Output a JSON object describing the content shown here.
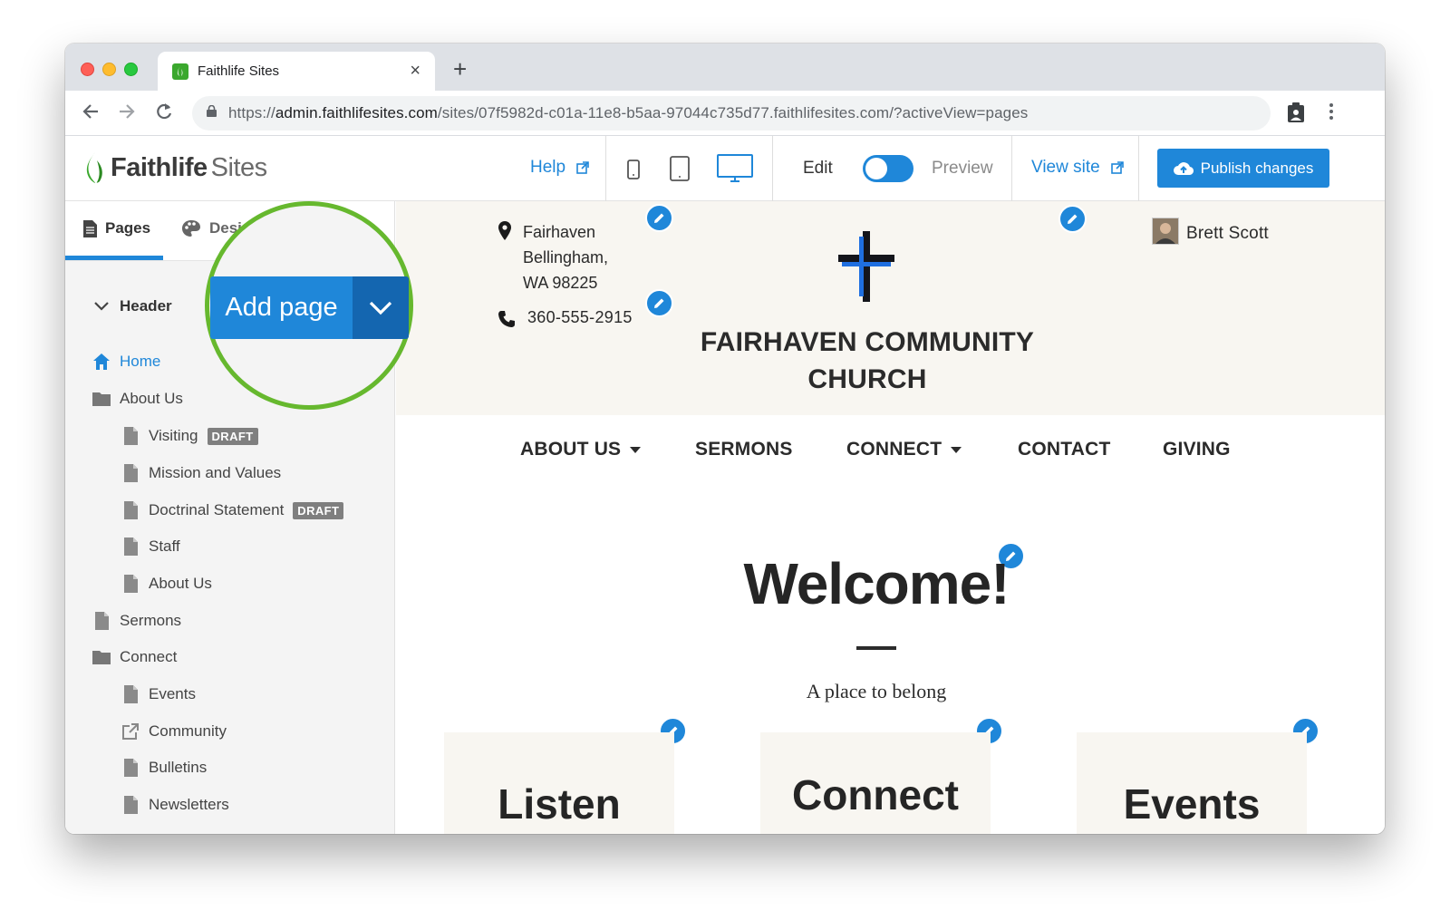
{
  "browser": {
    "tab_title": "Faithlife Sites",
    "tab_close": "×",
    "new_tab": "+",
    "url_prefix": "https://",
    "url_host": "admin.faithlifesites.com",
    "url_path": "/sites/07f5982d-c01a-11e8-b5aa-97044c735d77.faithlifesites.com/?activeView=pages",
    "back_icon": "arrow-left-icon",
    "forward_icon": "arrow-right-icon",
    "reload_icon": "reload-icon"
  },
  "app": {
    "logo_bold": "Faithlife",
    "logo_light": "Sites",
    "help": "Help",
    "edit": "Edit",
    "preview": "Preview",
    "view_site": "View site",
    "publish": "Publish changes",
    "toggle_on": true
  },
  "sidebar": {
    "tabs": [
      {
        "label": "Pages",
        "icon": "page-icon",
        "active": true
      },
      {
        "label": "Design",
        "icon": "palette-icon",
        "active": false
      }
    ],
    "section": "Header",
    "add_page": "Add page",
    "items": [
      {
        "label": "Home",
        "icon": "home-icon",
        "active": true
      },
      {
        "label": "About Us",
        "icon": "folder-icon"
      },
      {
        "label": "Visiting",
        "icon": "page-icon",
        "badge": "DRAFT"
      },
      {
        "label": "Mission and Values",
        "icon": "page-icon"
      },
      {
        "label": "Doctrinal Statement",
        "icon": "page-icon",
        "badge": "DRAFT"
      },
      {
        "label": "Staff",
        "icon": "page-icon"
      },
      {
        "label": "About Us",
        "icon": "page-icon"
      },
      {
        "label": "Sermons",
        "icon": "page-icon"
      },
      {
        "label": "Connect",
        "icon": "folder-icon"
      },
      {
        "label": "Events",
        "icon": "page-icon"
      },
      {
        "label": "Community",
        "icon": "external-link-icon"
      },
      {
        "label": "Bulletins",
        "icon": "page-icon"
      },
      {
        "label": "Newsletters",
        "icon": "page-icon"
      }
    ]
  },
  "site": {
    "address_line1": "Fairhaven",
    "address_line2": "Bellingham,",
    "address_line3": "WA 98225",
    "phone": "360-555-2915",
    "church_line1": "FAIRHAVEN COMMUNITY",
    "church_line2": "CHURCH",
    "user": "Brett Scott",
    "nav": [
      "ABOUT US",
      "SERMONS",
      "CONNECT",
      "CONTACT",
      "GIVING"
    ],
    "welcome": "Welcome!",
    "tagline": "A place to belong",
    "cards": [
      "Listen",
      "Connect",
      "Events"
    ]
  },
  "colors": {
    "accent": "#1f87d9",
    "callout": "#66b82e",
    "header_bg": "#f8f6f1"
  }
}
